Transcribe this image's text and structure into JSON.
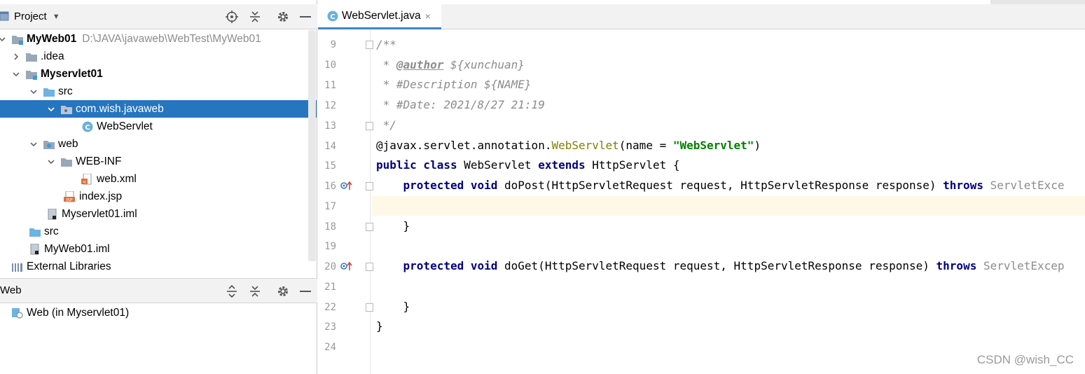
{
  "project_panel": {
    "title": "Project",
    "tree": [
      {
        "label": "MyWeb01",
        "path": "D:\\JAVA\\javaweb\\WebTest\\MyWeb01"
      },
      {
        "label": ".idea"
      },
      {
        "label": "Myservlet01"
      },
      {
        "label": "src"
      },
      {
        "label": "com.wish.javaweb"
      },
      {
        "label": "WebServlet"
      },
      {
        "label": "web"
      },
      {
        "label": "WEB-INF"
      },
      {
        "label": "web.xml"
      },
      {
        "label": "index.jsp"
      },
      {
        "label": "Myservlet01.iml"
      },
      {
        "label": "src"
      },
      {
        "label": "MyWeb01.iml"
      },
      {
        "label": "External Libraries"
      }
    ]
  },
  "web_panel": {
    "title": "Web",
    "items": [
      {
        "label": "Web (in Myservlet01)"
      }
    ]
  },
  "editor": {
    "tab": {
      "label": "WebServlet.java",
      "close": "×",
      "icon_letter": "C"
    },
    "line_numbers": [
      "9",
      "10",
      "11",
      "12",
      "13",
      "14",
      "15",
      "16",
      "17",
      "18",
      "19",
      "20",
      "21",
      "22",
      "23",
      "24"
    ],
    "code": {
      "l9": "/**",
      "l10_a": " * ",
      "l10_tag": "@author",
      "l10_b": " ${xunchuan}",
      "l11": " * #Description ${NAME}",
      "l12": " * #Date: 2021/8/27 21:19",
      "l13": " */",
      "l14_ann_at": "@javax.servlet.annotation.",
      "l14_ann_name": "WebServlet",
      "l14_a": "(name = ",
      "l14_str": "\"WebServlet\"",
      "l14_b": ")",
      "l15_kw": "public class",
      "l15_a": " WebServlet ",
      "l15_kw2": "extends",
      "l15_b": " HttpServlet {",
      "l16_kw": "protected void",
      "l16_a": " doPost(HttpServletRequest request, HttpServletResponse response) ",
      "l16_kw2": "throws",
      "l16_b": " ServletExce",
      "l18": "}",
      "l20_kw": "protected void",
      "l20_a": " doGet(HttpServletRequest request, HttpServletResponse response) ",
      "l20_kw2": "throws",
      "l20_b": " ServletExcep",
      "l22": "}",
      "l23": "}"
    }
  },
  "watermark": "CSDN @wish_CC",
  "colors": {
    "selection": "#2675bf",
    "keyword": "#000080",
    "annotation": "#808000",
    "string": "#008000",
    "comment": "#8c8c8c",
    "current_line": "#fdf9e6"
  }
}
